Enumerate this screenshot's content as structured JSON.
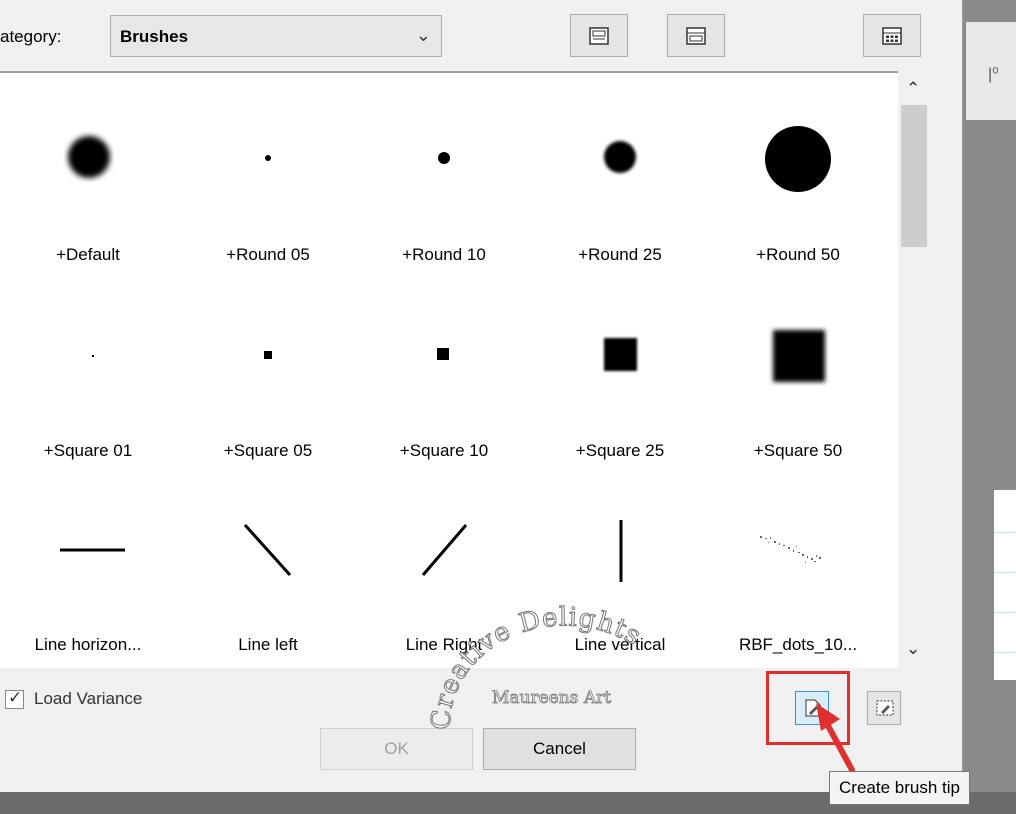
{
  "category": {
    "label": "ategory:",
    "selected": "Brushes"
  },
  "toolbar_icons": [
    "toggle-preview-icon",
    "open-folder-icon",
    "grid-view-icon"
  ],
  "brushes": [
    {
      "name": "+Default",
      "shape": "soft-circle"
    },
    {
      "name": "+Round 05",
      "shape": "circle"
    },
    {
      "name": "+Round 10",
      "shape": "circle"
    },
    {
      "name": "+Round 25",
      "shape": "soft-circle"
    },
    {
      "name": "+Round 50",
      "shape": "circle"
    },
    {
      "name": "+Square 01",
      "shape": "square"
    },
    {
      "name": "+Square 05",
      "shape": "square"
    },
    {
      "name": "+Square 10",
      "shape": "square"
    },
    {
      "name": "+Square 25",
      "shape": "soft-square"
    },
    {
      "name": "+Square 50",
      "shape": "soft-square"
    },
    {
      "name": "Line horizon...",
      "shape": "line-horizontal"
    },
    {
      "name": "Line left",
      "shape": "line-left"
    },
    {
      "name": "Line Right",
      "shape": "line-right"
    },
    {
      "name": "Line vertical",
      "shape": "line-vertical"
    },
    {
      "name": "RBF_dots_10...",
      "shape": "dots"
    }
  ],
  "load_variance": {
    "label": "Load Variance",
    "checked": true
  },
  "buttons": {
    "ok": "OK",
    "cancel": "Cancel"
  },
  "tooltip": "Create brush tip",
  "watermark": {
    "line1": "Creative Delights",
    "line2": "Maureens Art"
  },
  "colors": {
    "highlight": "#e02f2f",
    "accent": "#3c91d6"
  }
}
